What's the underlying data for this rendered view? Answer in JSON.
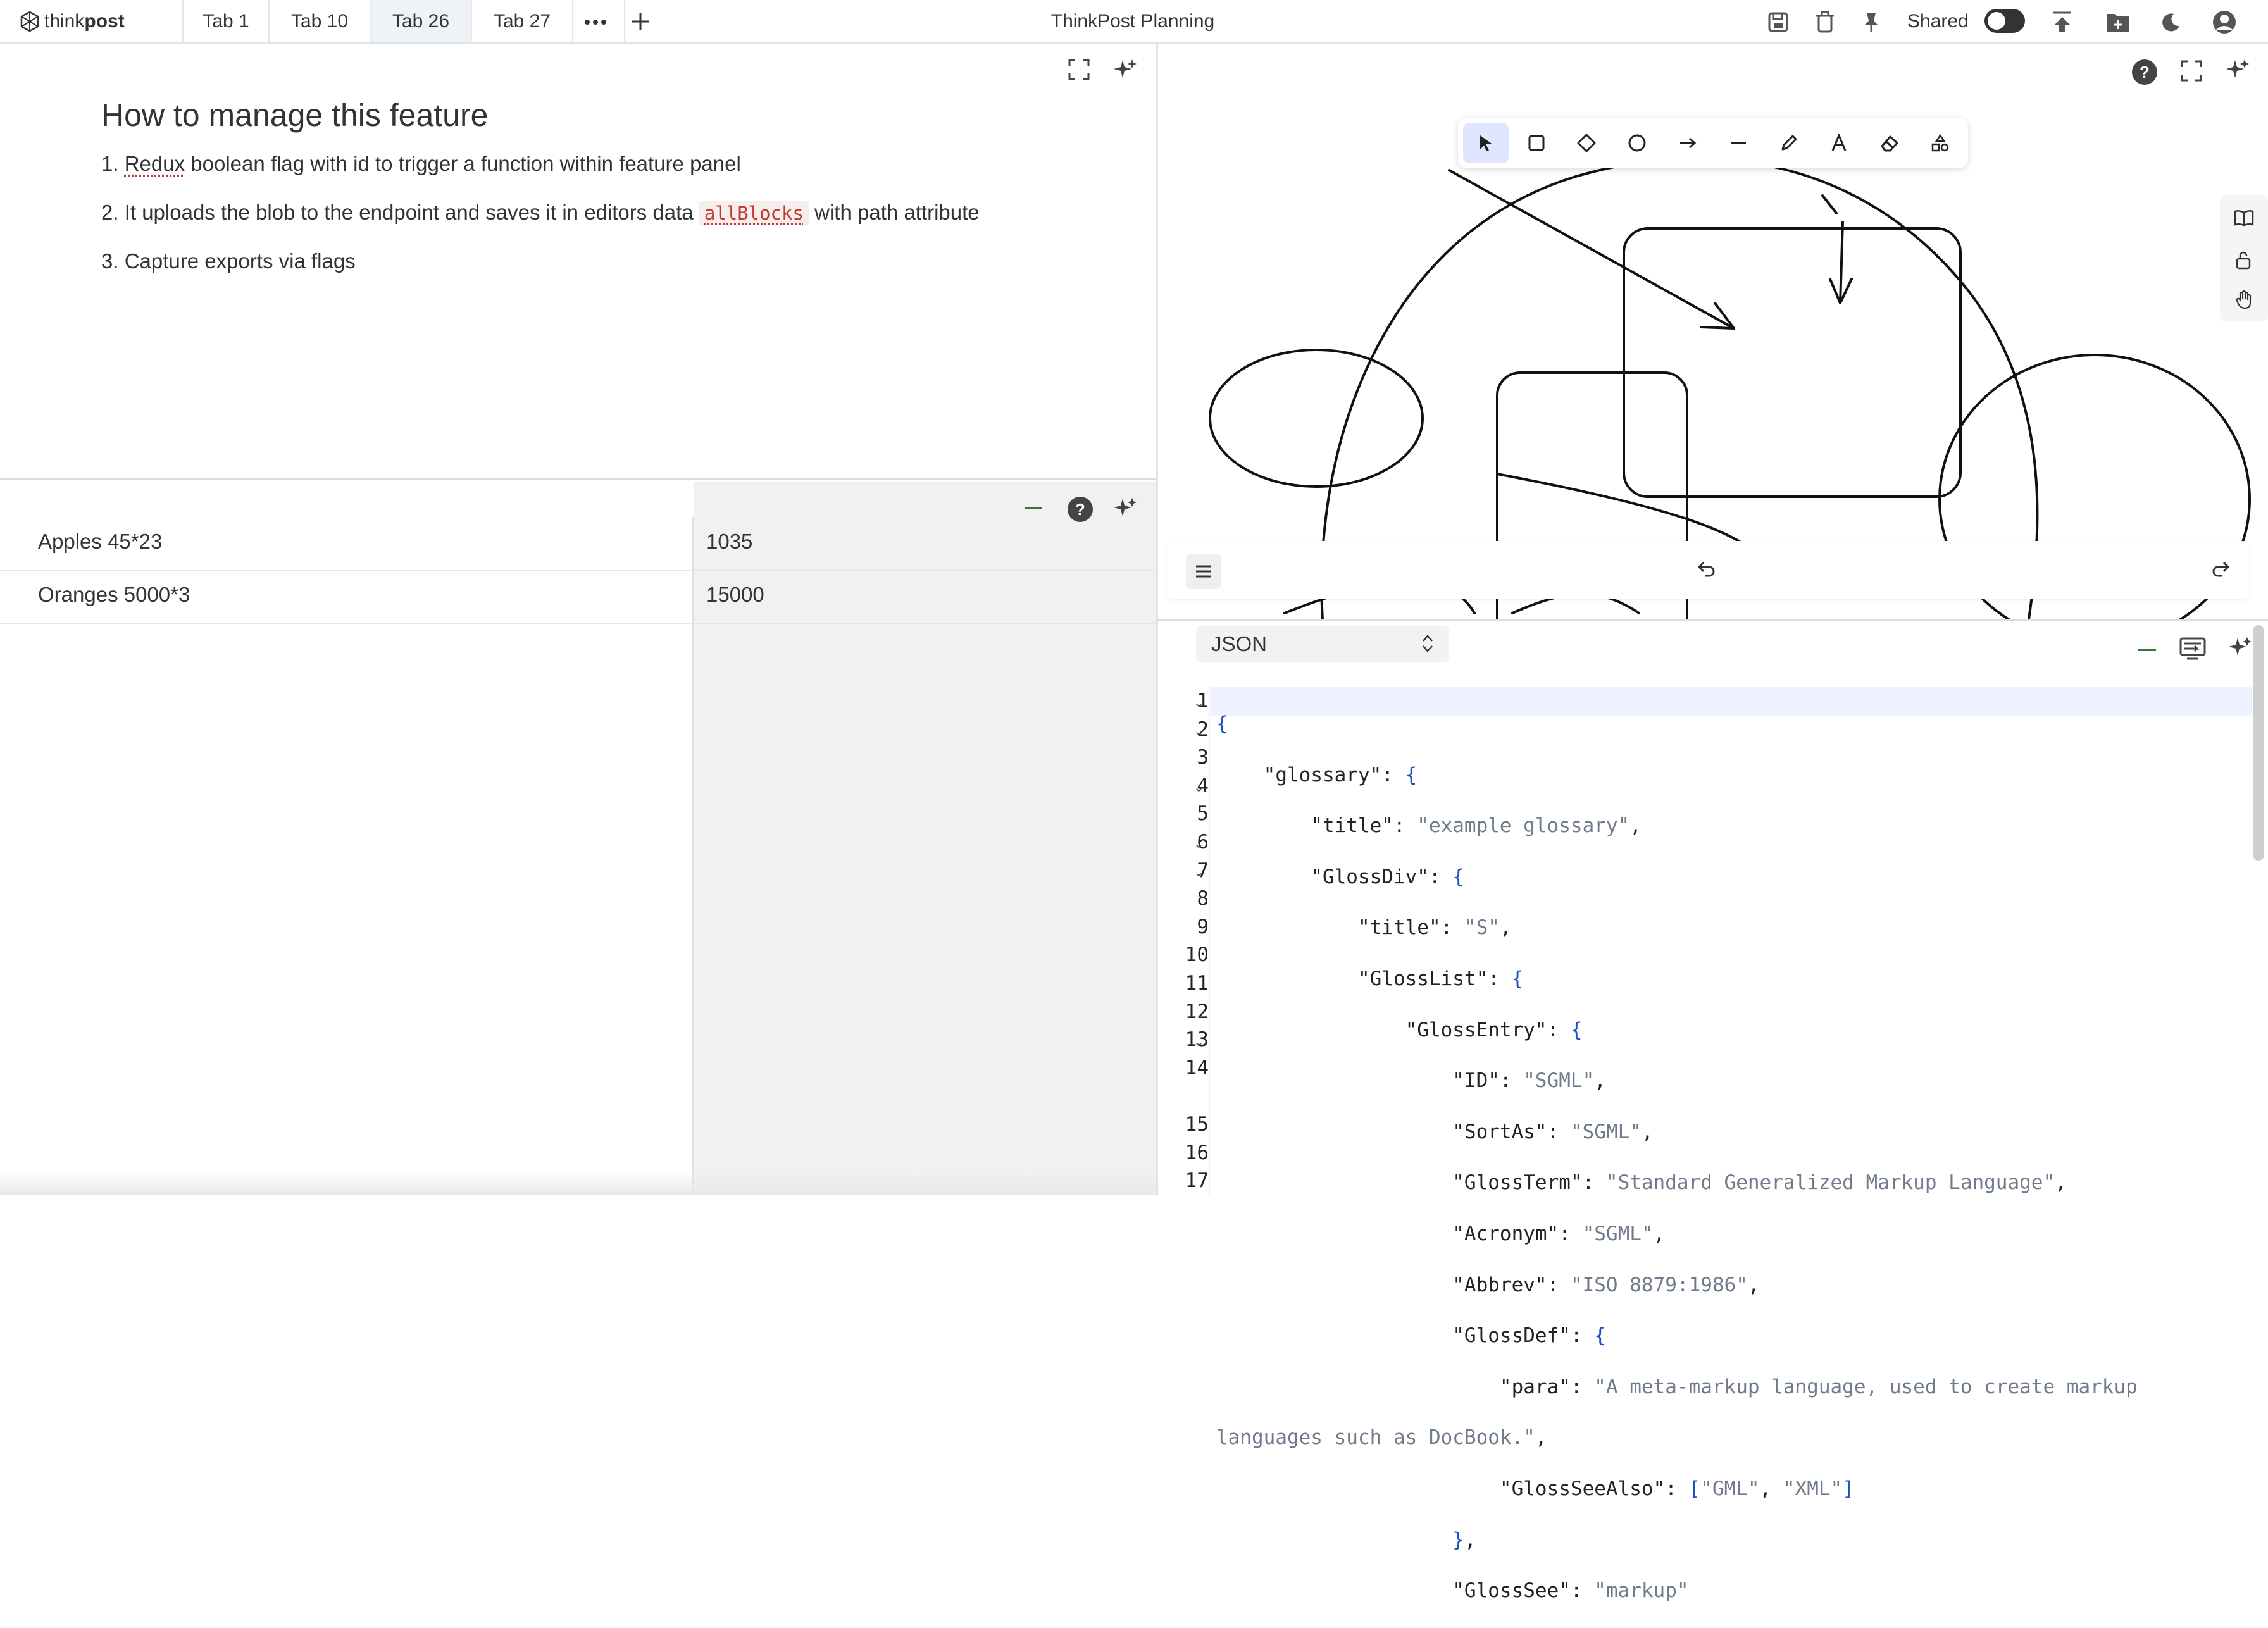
{
  "app": {
    "logo_prefix": "think",
    "logo_suffix": "post",
    "window_title": "ThinkPost Planning"
  },
  "tabs": [
    {
      "label": "Tab 1",
      "active": false
    },
    {
      "label": "Tab 10",
      "active": false
    },
    {
      "label": "Tab 26",
      "active": true
    },
    {
      "label": "Tab 27",
      "active": false
    }
  ],
  "header_actions": {
    "shared_label": "Shared",
    "shared_toggle": "off"
  },
  "doc": {
    "title": "How to manage this feature",
    "line1_prefix": "1. ",
    "line1_redux": "Redux",
    "line1_rest": " boolean flag with id to trigger a function within feature panel",
    "line2_prefix": "2. It uploads the blob to the endpoint and saves it in editors data ",
    "line2_code": "allBlocks",
    "line2_suffix": " with path attribute",
    "line3": "3. Capture exports via flags"
  },
  "sheet": {
    "rows": [
      {
        "label": "Apples 45*23",
        "value": "1035"
      },
      {
        "label": "Oranges 5000*3",
        "value": "15000"
      }
    ]
  },
  "canvas": {
    "tools": [
      "select-tool-icon",
      "rectangle-tool-icon",
      "diamond-tool-icon",
      "ellipse-tool-icon",
      "arrow-tool-icon",
      "line-tool-icon",
      "pencil-tool-icon",
      "text-tool-icon",
      "eraser-tool-icon",
      "shapes-library-icon"
    ],
    "selected_tool": "select-tool-icon"
  },
  "json_panel": {
    "mode": "JSON",
    "lines": [
      "1",
      "2",
      "3",
      "4",
      "5",
      "6",
      "7",
      "8",
      "9",
      "10",
      "11",
      "12",
      "13",
      "14",
      "",
      "15",
      "16",
      "17"
    ]
  },
  "colors": {
    "accent": "#2e7d32",
    "tab_active_bg": "#eef3f8",
    "json_string": "#6f7a8a",
    "json_punct": "#1f4fbf"
  }
}
